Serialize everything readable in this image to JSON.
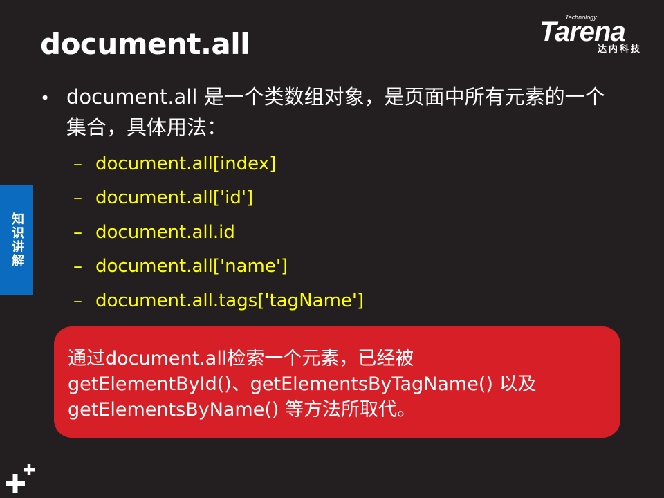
{
  "slide": {
    "title": "document.all",
    "logo": {
      "tagline": "Technology",
      "wordmark": "Tarena",
      "chinese": "达内科技"
    },
    "side_tab": "知识讲解",
    "bullet": {
      "marker": "•",
      "text": "document.all 是一个类数组对象，是页面中所有元素的一个集合，具体用法："
    },
    "sub_items": [
      {
        "dash": "–",
        "text": "document.all[index]"
      },
      {
        "dash": "–",
        "text": "document.all['id']"
      },
      {
        "dash": "–",
        "text": "document.all.id"
      },
      {
        "dash": "–",
        "text": "document.all['name']"
      },
      {
        "dash": "–",
        "text": "document.all.tags['tagName']"
      }
    ],
    "callout": {
      "line1": "通过document.all检索一个元素，已经被",
      "line2": "getElementById()、getElementsByTagName() 以及",
      "line3": "getElementsByName() 等方法所取代。"
    },
    "colors": {
      "background": "#231f20",
      "accent_blue": "#0a6bbf",
      "callout_red": "#d71f27",
      "code_yellow": "#ffff00"
    },
    "icons": {
      "bottom_left": "plus-plus-icon"
    }
  }
}
